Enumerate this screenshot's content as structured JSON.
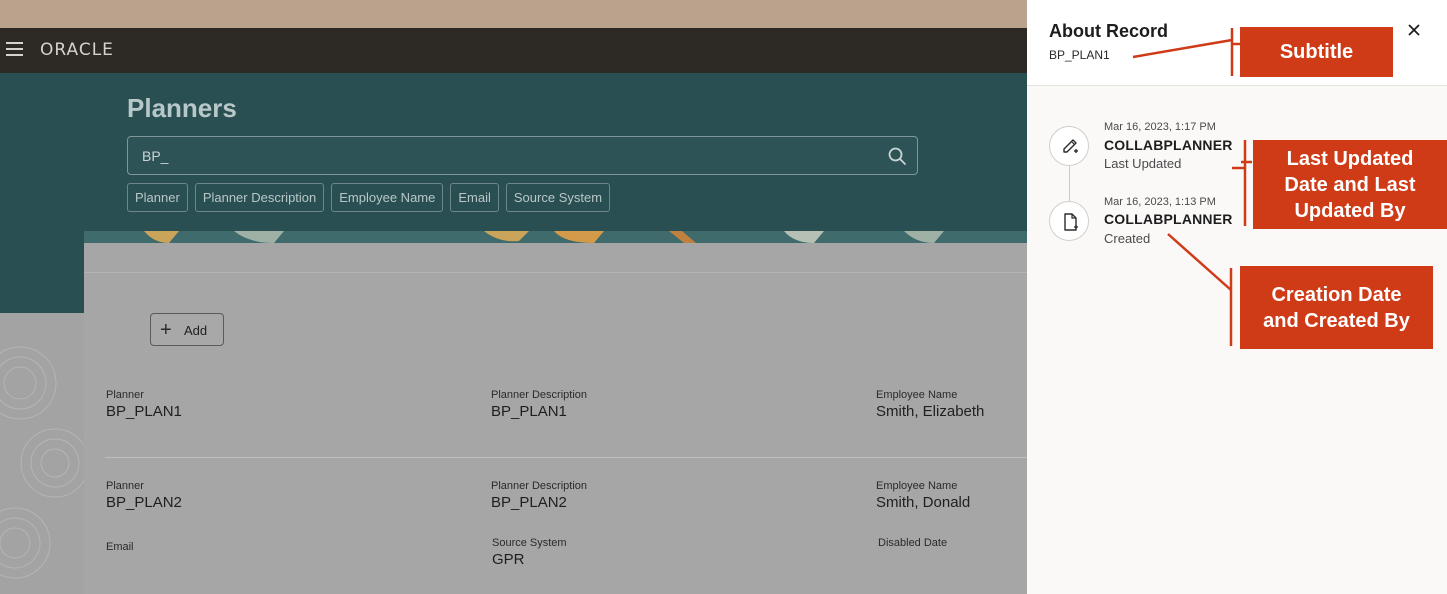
{
  "app": {
    "brand": "ORACLE",
    "page_title": "Planners",
    "search": {
      "value": "BP_"
    },
    "filter_chips": [
      "Planner",
      "Planner Description",
      "Employee Name",
      "Email",
      "Source System"
    ],
    "add_button": "Add",
    "records": [
      {
        "planner_label": "Planner",
        "planner": "BP_PLAN1",
        "desc_label": "Planner Description",
        "desc": "BP_PLAN1",
        "emp_label": "Employee Name",
        "emp": "Smith, Elizabeth"
      },
      {
        "planner_label": "Planner",
        "planner": "BP_PLAN2",
        "desc_label": "Planner Description",
        "desc": "BP_PLAN2",
        "emp_label": "Employee Name",
        "emp": "Smith, Donald",
        "email_label": "Email",
        "source_label": "Source System",
        "source": "GPR",
        "disabled_label": "Disabled Date"
      }
    ]
  },
  "panel": {
    "title": "About Record",
    "subtitle": "BP_PLAN1",
    "timeline": [
      {
        "date": "Mar 16, 2023, 1:17 PM",
        "user": "COLLABPLANNER",
        "action": "Last Updated",
        "icon": "edit-icon"
      },
      {
        "date": "Mar 16, 2023, 1:13 PM",
        "user": "COLLABPLANNER",
        "action": "Created",
        "icon": "document-add-icon"
      }
    ]
  },
  "annotations": {
    "subtitle": "Subtitle",
    "last_updated": "Last Updated\nDate and Last\nUpdated By",
    "creation": "Creation Date\nand Created By",
    "color": "#cf3a17"
  }
}
